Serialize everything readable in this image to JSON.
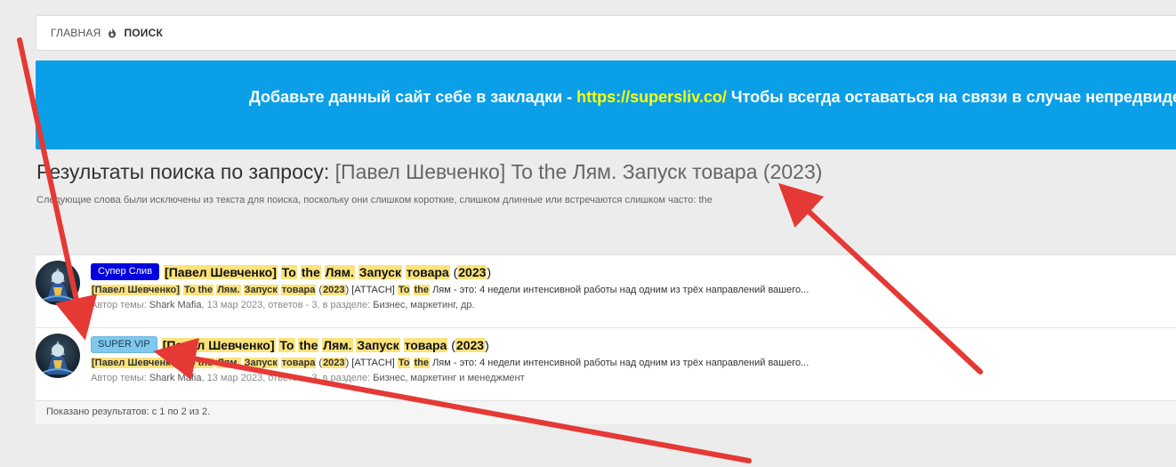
{
  "breadcrumb": {
    "items": [
      {
        "label": "Главная"
      },
      {
        "label": "Поиск"
      }
    ]
  },
  "banner": {
    "text_before": "Добавьте данный сайт себе в закладки - ",
    "link": "https://supersliv.co/",
    "text_after": " Чтобы всегда оставаться на связи в случае непредвиденн"
  },
  "search": {
    "title_prefix": "Результаты поиска по запросу: ",
    "query": "[Павел Шевченко] To the Лям. Запуск товара (2023)",
    "notice": "Следующие слова были исключены из текста для поиска, поскольку они слишком короткие, слишком длинные или встречаются слишком часто: the"
  },
  "results": [
    {
      "badge": "Супер Слив",
      "badge_color": "#0000e0",
      "title": {
        "w1": "[Павел Шевченко]",
        "w2": "To",
        "w3": "the",
        "w4": "Лям.",
        "w5": "Запуск",
        "w6": "товара",
        "w7": "2023"
      },
      "snippet": {
        "w1": "[Павел Шевченко]",
        "w2": "To the",
        "w3": "Лям.",
        "w4": "Запуск",
        "w5": "товара",
        "w6": "2023",
        "attach": "[ATTACH]",
        "w7": "To",
        "w8": "the",
        "rest": " Лям - это: 4 недели интенсивной работы над одним из трёх направлений вашего..."
      },
      "meta": {
        "author_label": "Автор темы: ",
        "author": "Shark Mafia",
        "date": ", 13 мар 2023, ответов - 3, в разделе: ",
        "section": "Бизнес, маркетинг, др."
      }
    },
    {
      "badge": "SUPER VIP",
      "badge_color": "#7fc8ee",
      "title": {
        "w1": "[Павел Шевченко]",
        "w2": "To",
        "w3": "the",
        "w4": "Лям.",
        "w5": "Запуск",
        "w6": "товара",
        "w7": "2023"
      },
      "snippet": {
        "w1": "[Павел Шевченко]",
        "w2": "To the",
        "w3": "Лям.",
        "w4": "Запуск",
        "w5": "товара",
        "w6": "2023",
        "attach": "[ATTACH]",
        "w7": "To",
        "w8": "the",
        "rest": " Лям - это: 4 недели интенсивной работы над одним из трёх направлений вашего..."
      },
      "meta": {
        "author_label": "Автор темы: ",
        "author": "Shark Mafia",
        "date": ", 13 мар 2023, ответов - 3, в разделе: ",
        "section": "Бизнес, маркетинг и менеджмент"
      }
    }
  ],
  "footer": {
    "summary": "Показано результатов: с 1 по 2 из 2."
  },
  "colors": {
    "banner_bg": "#0b9fe8",
    "banner_link": "#ffff00",
    "highlight": "#fbe27a",
    "arrow": "#e53935"
  },
  "icons": {
    "breadcrumb_separator": "flame-icon"
  }
}
